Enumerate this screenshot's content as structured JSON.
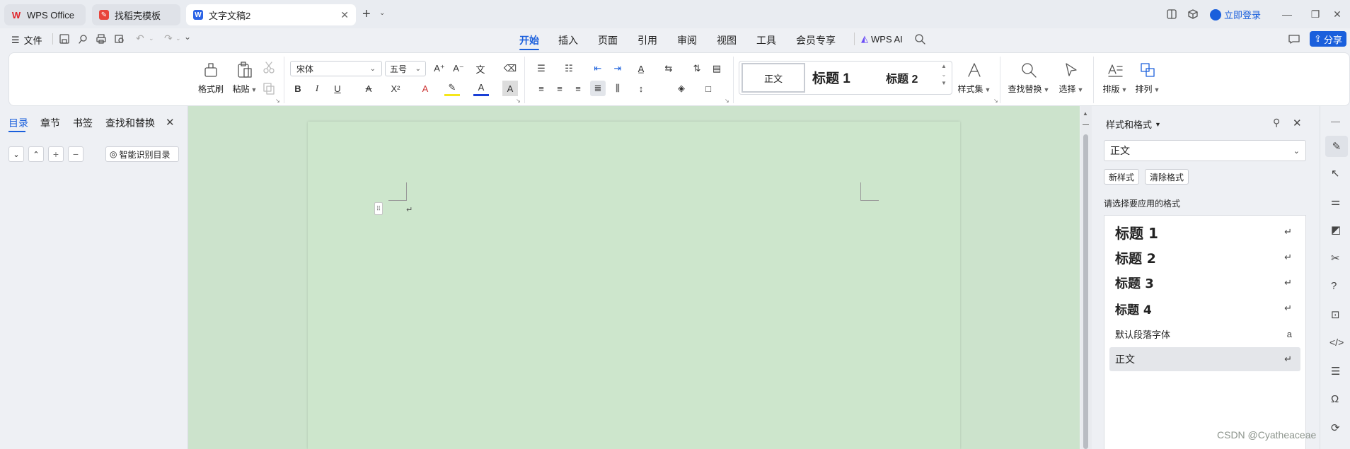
{
  "tabs": [
    {
      "label": "WPS Office"
    },
    {
      "label": "找稻壳模板"
    },
    {
      "label": "文字文稿2"
    }
  ],
  "titlebar": {
    "login": "立即登录"
  },
  "quick": {
    "file": "文件"
  },
  "menu": [
    "开始",
    "插入",
    "页面",
    "引用",
    "审阅",
    "视图",
    "工具",
    "会员专享"
  ],
  "wps_ai": "WPS AI",
  "share": "分享",
  "ribbon": {
    "format_painter": "格式刷",
    "paste": "粘贴",
    "font_name": "宋体",
    "font_size": "五号",
    "style_gallery": [
      "正文",
      "标题 1",
      "标题 2"
    ],
    "style_set": "样式集",
    "find_replace": "查找替换",
    "select": "选择",
    "layout": "排版",
    "arrange": "排列"
  },
  "left_panel": {
    "tabs": [
      "目录",
      "章节",
      "书签",
      "查找和替换"
    ],
    "smart_toc": "智能识别目录"
  },
  "styles_panel": {
    "title": "样式和格式",
    "current_style": "正文",
    "new_style": "新样式",
    "clear_format": "清除格式",
    "prompt": "请选择要应用的格式",
    "items": [
      "标题 1",
      "标题 2",
      "标题 3",
      "标题 4",
      "默认段落字体",
      "正文"
    ]
  },
  "watermark": "CSDN @Cyatheaceae",
  "colors": {
    "accent": "#1a5fdc",
    "doc_bg": "#cce3cc",
    "page_bg": "#cde6cc"
  }
}
